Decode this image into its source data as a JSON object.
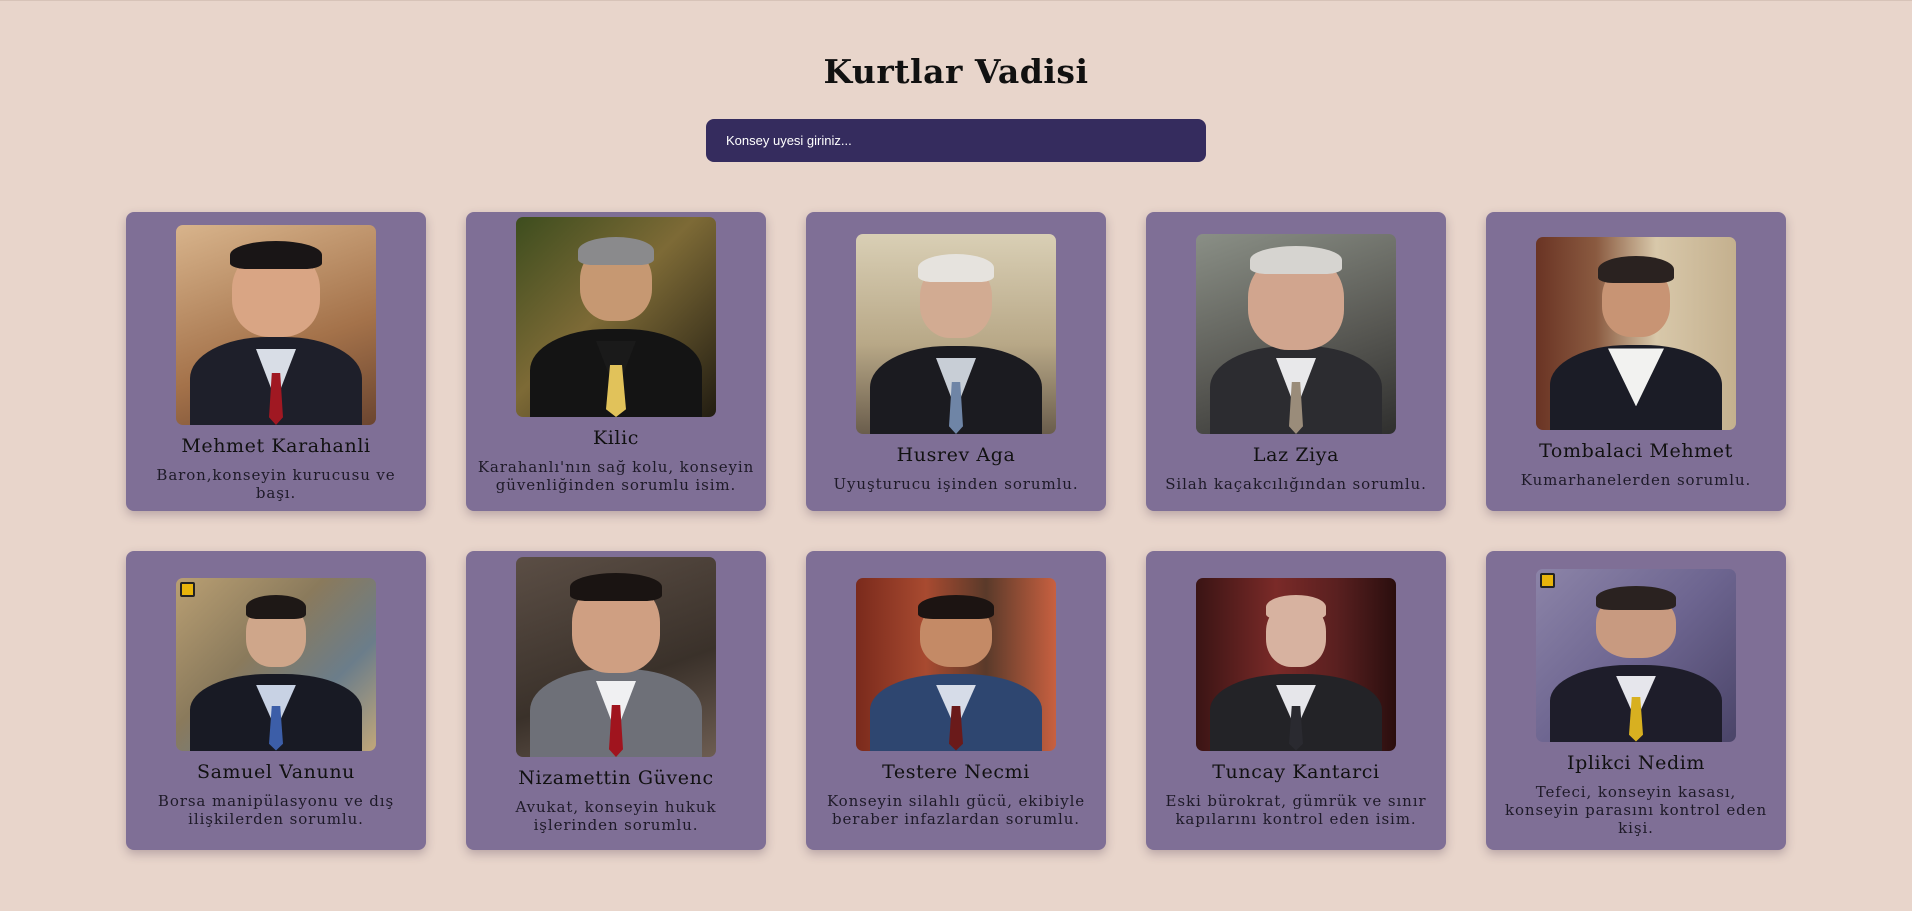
{
  "header": {
    "title": "Kurtlar Vadisi"
  },
  "search": {
    "placeholder": "Konsey uyesi giriniz..."
  },
  "members": [
    {
      "name": "Mehmet Karahanli",
      "description": "Baron,konseyin kurucusu ve başı."
    },
    {
      "name": "Kilic",
      "description": "Karahanlı'nın sağ kolu, konseyin güvenliğinden sorumlu isim."
    },
    {
      "name": "Husrev Aga",
      "description": "Uyuşturucu işinden sorumlu."
    },
    {
      "name": "Laz Ziya",
      "description": "Silah kaçakcılığından sorumlu."
    },
    {
      "name": "Tombalaci Mehmet",
      "description": "Kumarhanelerden sorumlu."
    },
    {
      "name": "Samuel Vanunu",
      "description": "Borsa manipülasyonu ve dış ilişkilerden sorumlu."
    },
    {
      "name": "Nizamettin Güvenc",
      "description": "Avukat, konseyin hukuk işlerinden sorumlu."
    },
    {
      "name": "Testere Necmi",
      "description": "Konseyin silahlı gücü, ekibiyle beraber infazlardan sorumlu."
    },
    {
      "name": "Tuncay Kantarci",
      "description": "Eski bürokrat, gümrük ve sınır kapılarını kontrol eden isim."
    },
    {
      "name": "Iplikci Nedim",
      "description": "Tefeci, konseyin kasası, konseyin parasını kontrol eden kişi."
    }
  ],
  "colors": {
    "page_background": "#e8d5cb",
    "search_background": "#352c5e",
    "card_background": "#7f6f96"
  }
}
